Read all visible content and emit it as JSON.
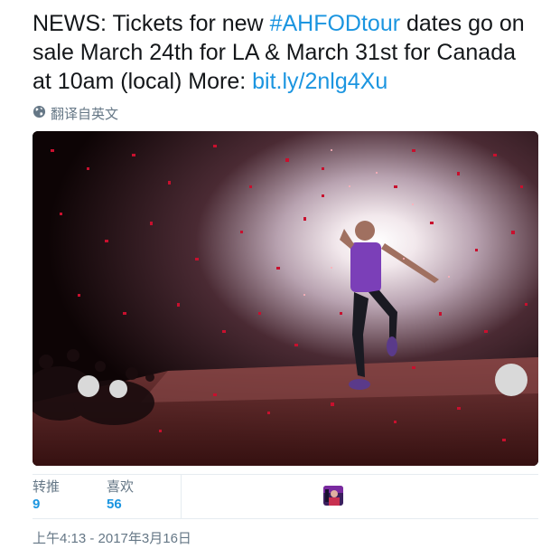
{
  "tweet": {
    "text_before": "NEWS: Tickets for new ",
    "hashtag": "#AHFODtour",
    "text_middle": " dates go on sale March 24th for LA & March 31st for Canada at 10am (local) More: ",
    "link": "bit.ly/2nlg4Xu"
  },
  "translate": {
    "label": "翻译自英文",
    "icon": "globe-icon"
  },
  "media": {
    "description_icon": "concert-photo"
  },
  "stats": {
    "retweets_label": "转推",
    "retweets_count": "9",
    "likes_label": "喜欢",
    "likes_count": "56"
  },
  "timestamp": "上午4:13 - 2017年3月16日",
  "colors": {
    "link": "#1b95e0",
    "text": "#14171a",
    "muted": "#657786",
    "confetti": "#c8102e"
  }
}
